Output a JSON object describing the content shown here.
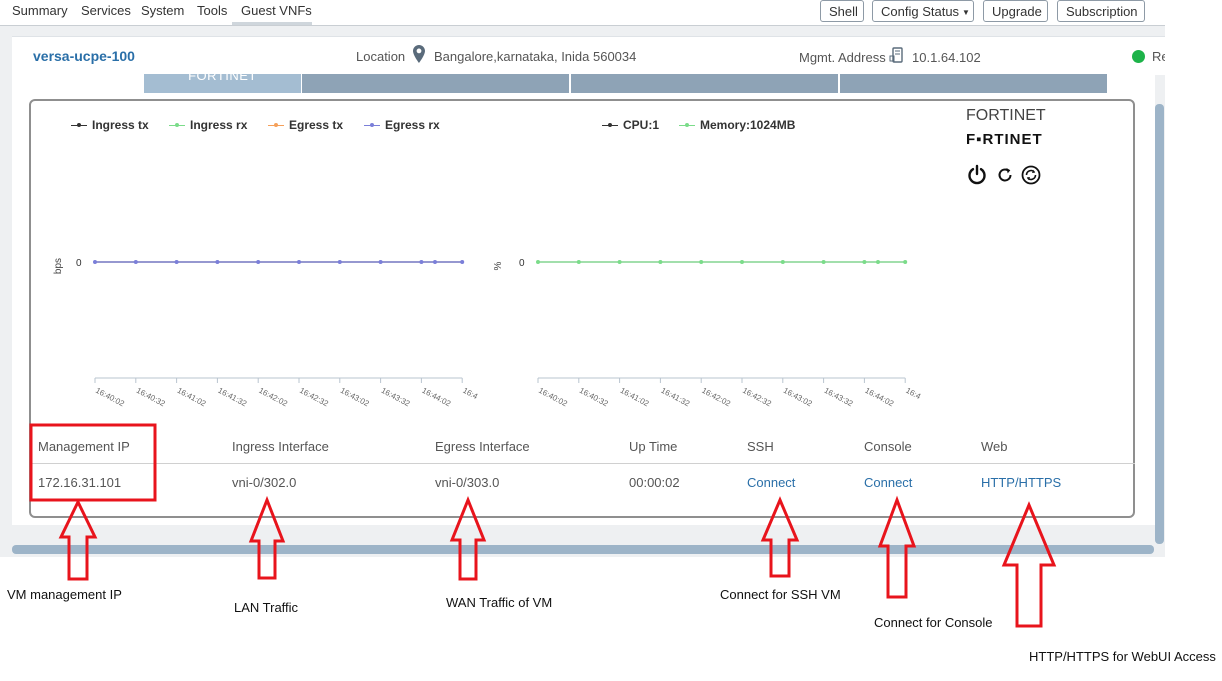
{
  "nav": {
    "tabs": [
      "Summary",
      "Services",
      "System",
      "Tools",
      "Guest VNFs"
    ],
    "buttons": {
      "shell": "Shell",
      "config_status": "Config Status",
      "upgrade": "Upgrade",
      "subscription": "Subscription"
    }
  },
  "device": {
    "name": "versa-ucpe-100",
    "location_label": "Location",
    "location_value": "Bangalore,karnataka, Inida 560034",
    "mgmt_label": "Mgmt. Address",
    "mgmt_value": "10.1.64.102",
    "status_text": "Re",
    "status_color": "#1db349"
  },
  "vnf_tabs": {
    "first_label": "FORTINET"
  },
  "card": {
    "brand_text": "FORTINET",
    "brand_logo": "F▪RTINET",
    "icons": [
      "power-icon",
      "refresh-icon",
      "sync-icon"
    ]
  },
  "traffic_legend": [
    {
      "label": "Ingress tx",
      "color": "#333333"
    },
    {
      "label": "Ingress rx",
      "color": "#7bdc8a"
    },
    {
      "label": "Egress tx",
      "color": "#f5a05a"
    },
    {
      "label": "Egress rx",
      "color": "#7b7fd9"
    }
  ],
  "resource_legend": [
    {
      "label": "CPU:1",
      "color": "#333333"
    },
    {
      "label": "Memory:1024MB",
      "color": "#7bdc8a"
    }
  ],
  "chart_data": [
    {
      "type": "line",
      "title": "",
      "ylabel": "bps",
      "x": [
        "16:40:02",
        "16:40:32",
        "16:41:02",
        "16:41:32",
        "16:42:02",
        "16:42:32",
        "16:43:02",
        "16:43:32",
        "16:44:02",
        "16:44:12",
        "16:44:32"
      ],
      "x_tick_labels": [
        "16:40:02",
        "16:40:32",
        "16:41:02",
        "16:41:32",
        "16:42:02",
        "16:42:32",
        "16:43:02",
        "16:43:32",
        "16:44:02",
        "16:4"
      ],
      "y_tick": "0",
      "series": [
        {
          "name": "Ingress tx",
          "values": [
            0,
            0,
            0,
            0,
            0,
            0,
            0,
            0,
            0,
            0,
            0
          ]
        },
        {
          "name": "Ingress rx",
          "values": [
            0,
            0,
            0,
            0,
            0,
            0,
            0,
            0,
            0,
            0,
            0
          ]
        },
        {
          "name": "Egress tx",
          "values": [
            0,
            0,
            0,
            0,
            0,
            0,
            0,
            0,
            0,
            0,
            0
          ]
        },
        {
          "name": "Egress rx",
          "values": [
            0,
            0,
            0,
            0,
            0,
            0,
            0,
            0,
            0,
            0,
            0
          ]
        }
      ],
      "line_color": "#7b7fd9"
    },
    {
      "type": "line",
      "title": "",
      "ylabel": "%",
      "x": [
        "16:40:02",
        "16:40:32",
        "16:41:02",
        "16:41:32",
        "16:42:02",
        "16:42:32",
        "16:43:02",
        "16:43:32",
        "16:44:02",
        "16:44:12",
        "16:44:32"
      ],
      "x_tick_labels": [
        "16:40:02",
        "16:40:32",
        "16:41:02",
        "16:41:32",
        "16:42:02",
        "16:42:32",
        "16:43:02",
        "16:43:32",
        "16:44:02",
        "16:4"
      ],
      "y_tick": "0",
      "series": [
        {
          "name": "CPU:1",
          "values": [
            0,
            0,
            0,
            0,
            0,
            0,
            0,
            0,
            0,
            0,
            0
          ]
        },
        {
          "name": "Memory:1024MB",
          "values": [
            0,
            0,
            0,
            0,
            0,
            0,
            0,
            0,
            0,
            0,
            0
          ]
        }
      ],
      "line_color": "#7bdc8a"
    }
  ],
  "table": {
    "headers": [
      "Management IP",
      "Ingress Interface",
      "Egress Interface",
      "Up Time",
      "SSH",
      "Console",
      "Web"
    ],
    "row": [
      "172.16.31.101",
      "vni-0/302.0",
      "vni-0/303.0",
      "00:00:02",
      "Connect",
      "Connect",
      "HTTP/HTTPS"
    ]
  },
  "annotations": [
    "VM management IP",
    "LAN Traffic",
    "WAN Traffic of VM",
    "Connect for  SSH VM",
    "Connect for Console",
    "HTTP/HTTPS for WebUI Access"
  ],
  "colors": {
    "annotation_red": "#e8141c",
    "link": "#2a6fa8"
  }
}
